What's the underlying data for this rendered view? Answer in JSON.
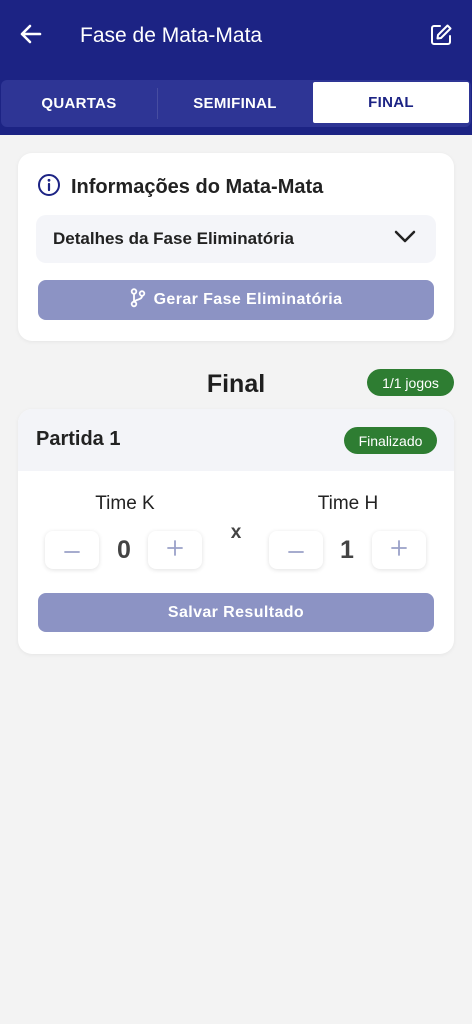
{
  "header": {
    "title": "Fase de Mata-Mata",
    "back_icon": "arrow-left-icon",
    "edit_icon": "edit-square-icon"
  },
  "tabs": [
    {
      "label": "QUARTAS",
      "active": false
    },
    {
      "label": "SEMIFINAL",
      "active": false
    },
    {
      "label": "FINAL",
      "active": true
    }
  ],
  "info_card": {
    "title": "Informações do Mata-Mata",
    "details_label": "Detalhes da Fase Eliminatória",
    "generate_button": "Gerar Fase Eliminatória"
  },
  "section": {
    "title": "Final",
    "count_badge": "1/1 jogos"
  },
  "match": {
    "name": "Partida 1",
    "status": "Finalizado",
    "team_a": {
      "name": "Time K",
      "score": "0"
    },
    "team_b": {
      "name": "Time H",
      "score": "1"
    },
    "versus": "x",
    "save_button": "Salvar Resultado"
  },
  "colors": {
    "primary": "#1c2384",
    "tab_bar": "#2e3595",
    "button_disabled": "#8c93c4",
    "success": "#2e7d32",
    "background": "#f3f3f3"
  }
}
